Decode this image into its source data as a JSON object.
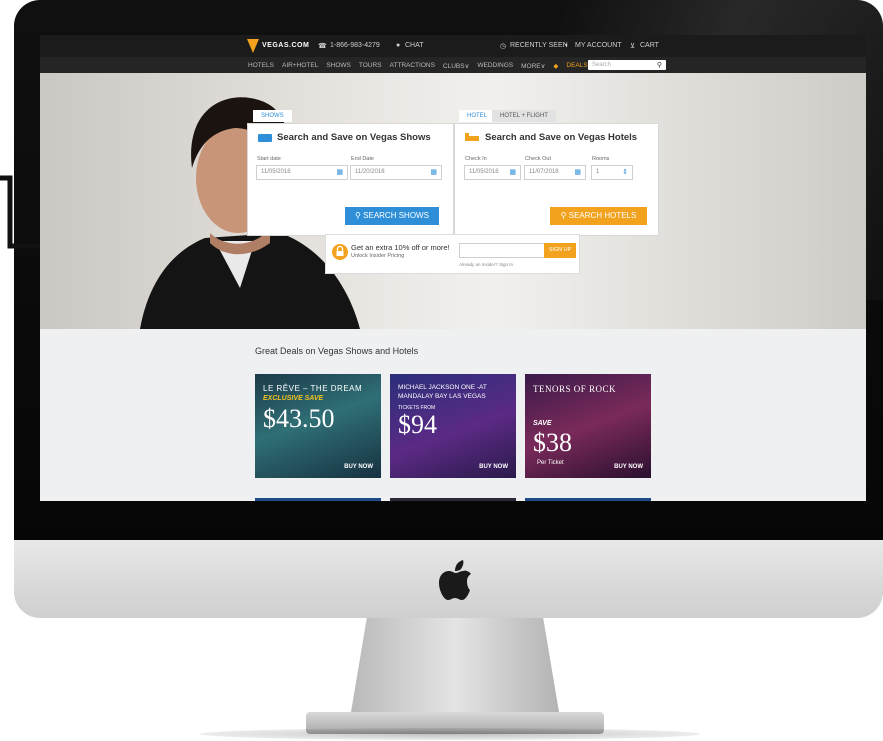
{
  "site": {
    "logo_text": "VEGAS.COM",
    "phone": "1-866-983-4279",
    "chat": "CHAT",
    "recently_seen": "RECENTLY SEEN",
    "my_account": "MY ACCOUNT",
    "cart": "CART"
  },
  "nav": {
    "items": [
      "HOTELS",
      "AIR+HOTEL",
      "SHOWS",
      "TOURS",
      "ATTRACTIONS",
      "CLUBS∨",
      "WEDDINGS",
      "MORE∨"
    ],
    "deals": "DEALS",
    "search_placeholder": "Search"
  },
  "shows_panel": {
    "tab": "SHOWS",
    "title": "Search and Save on Vegas Shows",
    "start_label": "Start date",
    "start_value": "11/05/2018",
    "end_label": "End Date",
    "end_value": "11/20/2018",
    "button": "SEARCH SHOWS"
  },
  "hotels_panel": {
    "tab_hotel": "HOTEL",
    "tab_hotel_flight": "HOTEL + FLIGHT",
    "title": "Search and Save on Vegas Hotels",
    "checkin_label": "Check In",
    "checkin_value": "11/05/2018",
    "checkout_label": "Check Out",
    "checkout_value": "11/07/2018",
    "rooms_label": "Rooms",
    "rooms_value": "1",
    "button": "SEARCH HOTELS"
  },
  "insider": {
    "headline": "Get an extra 10% off or more!",
    "sub": "Unlock Insider Pricing",
    "button": "SIGN UP",
    "already": "Already an Insider? Sign In"
  },
  "deals": {
    "title": "Great Deals on Vegas Shows and Hotels",
    "cards": [
      {
        "line1": "LE RÊVE – THE DREAM",
        "line2": "EXCLUSIVE SAVE",
        "price": "$43.50",
        "cta": "BUY NOW"
      },
      {
        "line1": "MICHAEL JACKSON ONE -AT",
        "line2": "MANDALAY BAY LAS VEGAS",
        "line3": "TICKETS FROM",
        "price": "$94",
        "cta": "BUY NOW"
      },
      {
        "line1": "TENORS OF ROCK",
        "line2": "SAVE",
        "price": "$38",
        "line3": "Per Ticket",
        "cta": "BUY NOW"
      }
    ]
  },
  "colors": {
    "blue_button": "#2e8fd8",
    "orange_button": "#f3a21e",
    "topbar": "#1b1b1b"
  }
}
